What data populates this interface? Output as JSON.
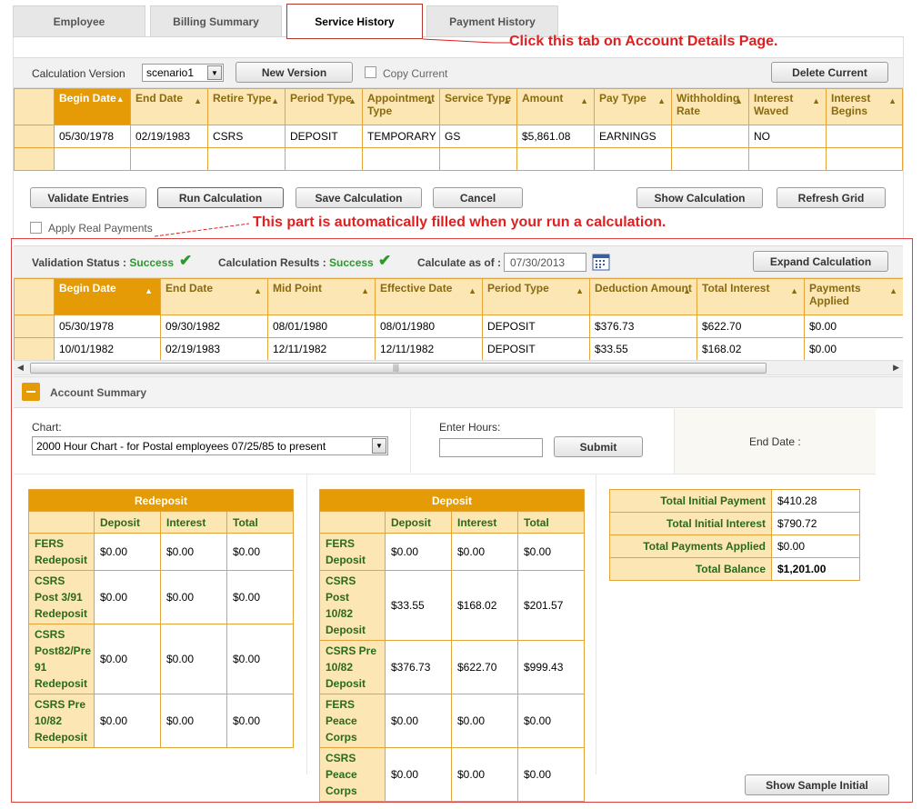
{
  "tabs": [
    "Employee",
    "Billing Summary",
    "Service History",
    "Payment History"
  ],
  "annotations": {
    "tab_note": "Click this tab on Account Details Page.",
    "calc_note": "This part is automatically filled when your run a calculation."
  },
  "version_bar": {
    "label": "Calculation Version",
    "selected": "scenario1",
    "new_version": "New Version",
    "copy_current": "Copy Current",
    "delete_current": "Delete Current"
  },
  "service_grid": {
    "columns": [
      "Begin Date",
      "End Date",
      "Retire Type",
      "Period Type",
      "Appointment Type",
      "Service Type",
      "Amount",
      "Pay Type",
      "Withholding Rate",
      "Interest Waved",
      "Interest Begins"
    ],
    "rows": [
      [
        "05/30/1978",
        "02/19/1983",
        "CSRS",
        "DEPOSIT",
        "TEMPORARY",
        "GS",
        "$5,861.08",
        "EARNINGS",
        "",
        "NO",
        ""
      ]
    ]
  },
  "actions": {
    "validate": "Validate Entries",
    "run": "Run Calculation",
    "save": "Save Calculation",
    "cancel": "Cancel",
    "show": "Show Calculation",
    "refresh": "Refresh Grid",
    "apply_real": "Apply Real Payments"
  },
  "status_bar": {
    "validation_label": "Validation Status :",
    "validation_value": "Success",
    "results_label": "Calculation Results :",
    "results_value": "Success",
    "calc_as_of_label": "Calculate as of :",
    "calc_as_of_value": "07/30/2013",
    "expand": "Expand Calculation"
  },
  "results_grid": {
    "columns": [
      "Begin Date",
      "End Date",
      "Mid Point",
      "Effective Date",
      "Period Type",
      "Deduction Amount",
      "Total Interest",
      "Payments Applied"
    ],
    "rows": [
      [
        "05/30/1978",
        "09/30/1982",
        "08/01/1980",
        "08/01/1980",
        "DEPOSIT",
        "$376.73",
        "$622.70",
        "$0.00"
      ],
      [
        "10/01/1982",
        "02/19/1983",
        "12/11/1982",
        "12/11/1982",
        "DEPOSIT",
        "$33.55",
        "$168.02",
        "$0.00"
      ]
    ]
  },
  "account_summary": {
    "title": "Account Summary",
    "chart_label": "Chart:",
    "chart_value": "2000 Hour Chart - for Postal employees 07/25/85 to present",
    "hours_label": "Enter Hours:",
    "submit": "Submit",
    "end_date_label": "End Date :"
  },
  "redeposit": {
    "title": "Redeposit",
    "cols": [
      "Deposit",
      "Interest",
      "Total"
    ],
    "rows": [
      {
        "label": "FERS Redeposit",
        "vals": [
          "$0.00",
          "$0.00",
          "$0.00"
        ]
      },
      {
        "label": "CSRS Post 3/91 Redeposit",
        "vals": [
          "$0.00",
          "$0.00",
          "$0.00"
        ]
      },
      {
        "label": "CSRS Post82/Pre 91 Redeposit",
        "vals": [
          "$0.00",
          "$0.00",
          "$0.00"
        ]
      },
      {
        "label": "CSRS Pre 10/82 Redeposit",
        "vals": [
          "$0.00",
          "$0.00",
          "$0.00"
        ]
      }
    ]
  },
  "deposit": {
    "title": "Deposit",
    "cols": [
      "Deposit",
      "Interest",
      "Total"
    ],
    "rows": [
      {
        "label": "FERS Deposit",
        "vals": [
          "$0.00",
          "$0.00",
          "$0.00"
        ]
      },
      {
        "label": "CSRS Post 10/82 Deposit",
        "vals": [
          "$33.55",
          "$168.02",
          "$201.57"
        ]
      },
      {
        "label": "CSRS Pre 10/82 Deposit",
        "vals": [
          "$376.73",
          "$622.70",
          "$999.43"
        ]
      },
      {
        "label": "FERS Peace Corps",
        "vals": [
          "$0.00",
          "$0.00",
          "$0.00"
        ]
      },
      {
        "label": "CSRS Peace Corps",
        "vals": [
          "$0.00",
          "$0.00",
          "$0.00"
        ]
      }
    ]
  },
  "totals": [
    {
      "label": "Total Initial Payment",
      "value": "$410.28"
    },
    {
      "label": "Total Initial Interest",
      "value": "$790.72"
    },
    {
      "label": "Total Payments Applied",
      "value": "$0.00"
    },
    {
      "label": "Total Balance",
      "value": "$1,201.00"
    }
  ],
  "show_sample": "Show Sample Initial",
  "colors": {
    "accent": "#e59b06",
    "light": "#fbe6b4",
    "annotation": "#e02020",
    "success": "#2a9a2a"
  }
}
